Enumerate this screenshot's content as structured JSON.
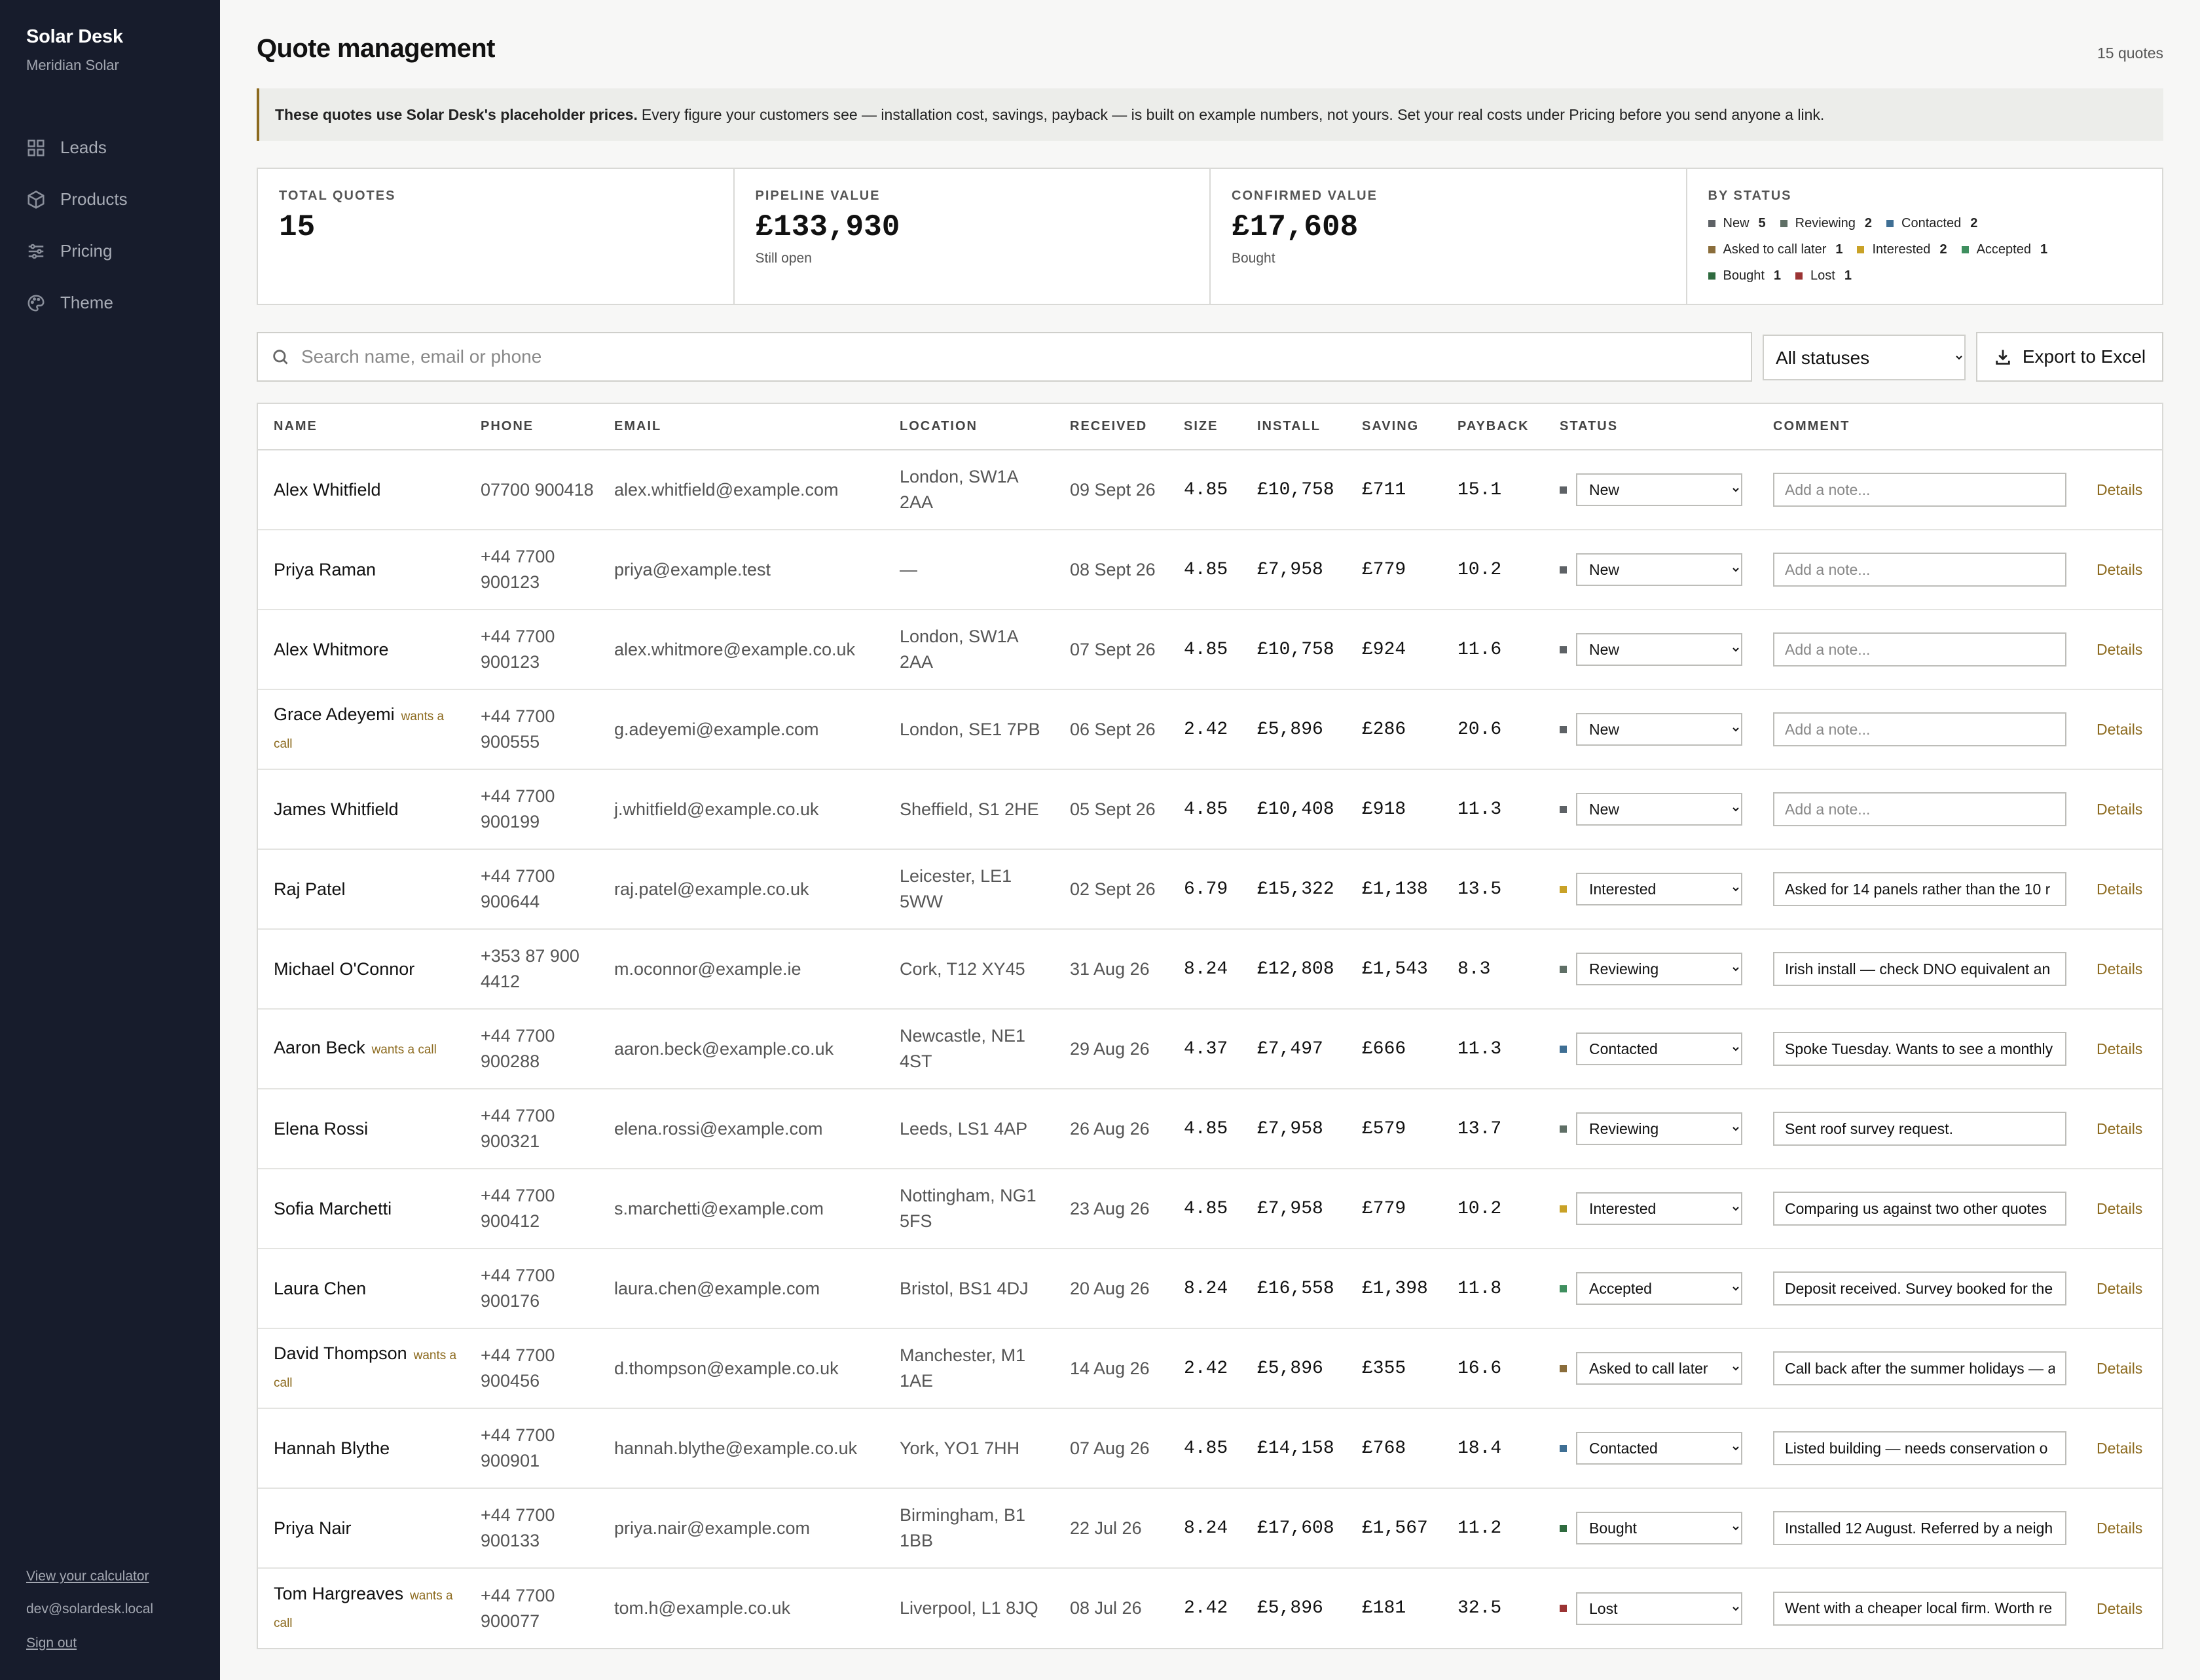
{
  "sidebar": {
    "brand": "Solar Desk",
    "org": "Meridian Solar",
    "nav": [
      {
        "label": "Leads",
        "icon": "grid-icon"
      },
      {
        "label": "Products",
        "icon": "box-icon"
      },
      {
        "label": "Pricing",
        "icon": "sliders-icon"
      },
      {
        "label": "Theme",
        "icon": "palette-icon"
      }
    ],
    "calculator_link": "View your calculator",
    "user_email": "dev@solardesk.local",
    "sign_out": "Sign out"
  },
  "header": {
    "title": "Quote management",
    "count": "15 quotes"
  },
  "banner": {
    "bold": "These quotes use Solar Desk's placeholder prices.",
    "text": "Every figure your customers see — installation cost, savings, payback — is built on example numbers, not yours. Set your real costs under Pricing before you send anyone a link."
  },
  "stats": {
    "total": {
      "label": "Total quotes",
      "value": "15"
    },
    "pipeline": {
      "label": "Pipeline value",
      "value": "£133,930",
      "sub": "Still open"
    },
    "confirmed": {
      "label": "Confirmed value",
      "value": "£17,608",
      "sub": "Bought"
    },
    "by_status": {
      "label": "By status",
      "items": [
        {
          "label": "New",
          "count": "5",
          "color": "#5e6266"
        },
        {
          "label": "Reviewing",
          "count": "2",
          "color": "#5f6f66"
        },
        {
          "label": "Contacted",
          "count": "2",
          "color": "#3f6f94"
        },
        {
          "label": "Asked to call later",
          "count": "1",
          "color": "#8a6d3b"
        },
        {
          "label": "Interested",
          "count": "2",
          "color": "#c9a227"
        },
        {
          "label": "Accepted",
          "count": "1",
          "color": "#3f8f5f"
        },
        {
          "label": "Bought",
          "count": "1",
          "color": "#2f6b3f"
        },
        {
          "label": "Lost",
          "count": "1",
          "color": "#9b3434"
        }
      ]
    }
  },
  "toolbar": {
    "search_placeholder": "Search name, email or phone",
    "status_filter": "All statuses",
    "export_label": "Export to Excel"
  },
  "table": {
    "columns": [
      "Name",
      "Phone",
      "Email",
      "Location",
      "Received",
      "Size",
      "Install",
      "Saving",
      "Payback",
      "Status",
      "Comment",
      ""
    ],
    "note_placeholder": "Add a note...",
    "details_label": "Details",
    "rows": [
      {
        "name": "Alex Whitfield",
        "wants": "",
        "phone": "07700 900418",
        "email": "alex.whitfield@example.com",
        "location": "London, SW1A 2AA",
        "received": "09 Sept 26",
        "size": "4.85",
        "install": "£10,758",
        "saving": "£711",
        "payback": "15.1",
        "status": "New",
        "status_color": "#5e6266",
        "comment": ""
      },
      {
        "name": "Priya Raman",
        "wants": "",
        "phone": "+44 7700 900123",
        "email": "priya@example.test",
        "location": "—",
        "received": "08 Sept 26",
        "size": "4.85",
        "install": "£7,958",
        "saving": "£779",
        "payback": "10.2",
        "status": "New",
        "status_color": "#5e6266",
        "comment": ""
      },
      {
        "name": "Alex Whitmore",
        "wants": "",
        "phone": "+44 7700 900123",
        "email": "alex.whitmore@example.co.uk",
        "location": "London, SW1A 2AA",
        "received": "07 Sept 26",
        "size": "4.85",
        "install": "£10,758",
        "saving": "£924",
        "payback": "11.6",
        "status": "New",
        "status_color": "#5e6266",
        "comment": ""
      },
      {
        "name": "Grace Adeyemi",
        "wants": "wants a call",
        "phone": "+44 7700 900555",
        "email": "g.adeyemi@example.com",
        "location": "London, SE1 7PB",
        "received": "06 Sept 26",
        "size": "2.42",
        "install": "£5,896",
        "saving": "£286",
        "payback": "20.6",
        "status": "New",
        "status_color": "#5e6266",
        "comment": ""
      },
      {
        "name": "James Whitfield",
        "wants": "",
        "phone": "+44 7700 900199",
        "email": "j.whitfield@example.co.uk",
        "location": "Sheffield, S1 2HE",
        "received": "05 Sept 26",
        "size": "4.85",
        "install": "£10,408",
        "saving": "£918",
        "payback": "11.3",
        "status": "New",
        "status_color": "#5e6266",
        "comment": ""
      },
      {
        "name": "Raj Patel",
        "wants": "",
        "phone": "+44 7700 900644",
        "email": "raj.patel@example.co.uk",
        "location": "Leicester, LE1 5WW",
        "received": "02 Sept 26",
        "size": "6.79",
        "install": "£15,322",
        "saving": "£1,138",
        "payback": "13.5",
        "status": "Interested",
        "status_color": "#c9a227",
        "comment": "Asked for 14 panels rather than the 10 r"
      },
      {
        "name": "Michael O'Connor",
        "wants": "",
        "phone": "+353 87 900 4412",
        "email": "m.oconnor@example.ie",
        "location": "Cork, T12 XY45",
        "received": "31 Aug 26",
        "size": "8.24",
        "install": "£12,808",
        "saving": "£1,543",
        "payback": "8.3",
        "status": "Reviewing",
        "status_color": "#5f6f66",
        "comment": "Irish install — check DNO equivalent an"
      },
      {
        "name": "Aaron Beck",
        "wants": "wants a call",
        "phone": "+44 7700 900288",
        "email": "aaron.beck@example.co.uk",
        "location": "Newcastle, NE1 4ST",
        "received": "29 Aug 26",
        "size": "4.37",
        "install": "£7,497",
        "saving": "£666",
        "payback": "11.3",
        "status": "Contacted",
        "status_color": "#3f6f94",
        "comment": "Spoke Tuesday. Wants to see a monthly"
      },
      {
        "name": "Elena Rossi",
        "wants": "",
        "phone": "+44 7700 900321",
        "email": "elena.rossi@example.com",
        "location": "Leeds, LS1 4AP",
        "received": "26 Aug 26",
        "size": "4.85",
        "install": "£7,958",
        "saving": "£579",
        "payback": "13.7",
        "status": "Reviewing",
        "status_color": "#5f6f66",
        "comment": "Sent roof survey request."
      },
      {
        "name": "Sofia Marchetti",
        "wants": "",
        "phone": "+44 7700 900412",
        "email": "s.marchetti@example.com",
        "location": "Nottingham, NG1 5FS",
        "received": "23 Aug 26",
        "size": "4.85",
        "install": "£7,958",
        "saving": "£779",
        "payback": "10.2",
        "status": "Interested",
        "status_color": "#c9a227",
        "comment": "Comparing us against two other quotes"
      },
      {
        "name": "Laura Chen",
        "wants": "",
        "phone": "+44 7700 900176",
        "email": "laura.chen@example.com",
        "location": "Bristol, BS1 4DJ",
        "received": "20 Aug 26",
        "size": "8.24",
        "install": "£16,558",
        "saving": "£1,398",
        "payback": "11.8",
        "status": "Accepted",
        "status_color": "#3f8f5f",
        "comment": "Deposit received. Survey booked for the"
      },
      {
        "name": "David Thompson",
        "wants": "wants a call",
        "phone": "+44 7700 900456",
        "email": "d.thompson@example.co.uk",
        "location": "Manchester, M1 1AE",
        "received": "14 Aug 26",
        "size": "2.42",
        "install": "£5,896",
        "saving": "£355",
        "payback": "16.6",
        "status": "Asked to call later",
        "status_color": "#8a6d3b",
        "comment": "Call back after the summer holidays — a"
      },
      {
        "name": "Hannah Blythe",
        "wants": "",
        "phone": "+44 7700 900901",
        "email": "hannah.blythe@example.co.uk",
        "location": "York, YO1 7HH",
        "received": "07 Aug 26",
        "size": "4.85",
        "install": "£14,158",
        "saving": "£768",
        "payback": "18.4",
        "status": "Contacted",
        "status_color": "#3f6f94",
        "comment": "Listed building — needs conservation o"
      },
      {
        "name": "Priya Nair",
        "wants": "",
        "phone": "+44 7700 900133",
        "email": "priya.nair@example.com",
        "location": "Birmingham, B1 1BB",
        "received": "22 Jul 26",
        "size": "8.24",
        "install": "£17,608",
        "saving": "£1,567",
        "payback": "11.2",
        "status": "Bought",
        "status_color": "#2f6b3f",
        "comment": "Installed 12 August. Referred by a neigh"
      },
      {
        "name": "Tom Hargreaves",
        "wants": "wants a call",
        "phone": "+44 7700 900077",
        "email": "tom.h@example.co.uk",
        "location": "Liverpool, L1 8JQ",
        "received": "08 Jul 26",
        "size": "2.42",
        "install": "£5,896",
        "saving": "£181",
        "payback": "32.5",
        "status": "Lost",
        "status_color": "#9b3434",
        "comment": "Went with a cheaper local firm. Worth re"
      }
    ]
  }
}
